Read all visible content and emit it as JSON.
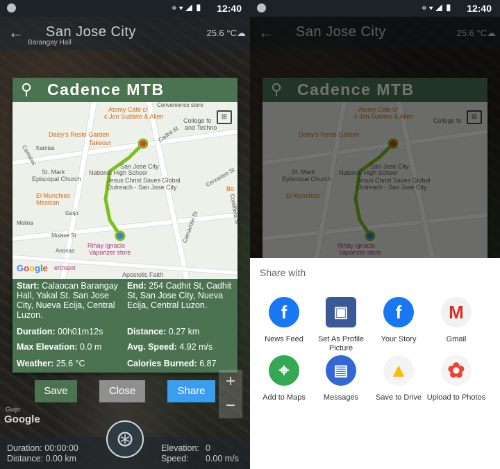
{
  "status": {
    "time": "12:40",
    "icons": "⌖▾◢▮"
  },
  "topbar": {
    "back": "←",
    "title": "San Jose City",
    "weather": "25.6 °C☁"
  },
  "dialog": {
    "app_name": "Cadence MTB",
    "map": {
      "labels": [
        "Atomy Cafe c/",
        "c Jon Sudario & Allen",
        "Daisy's Resto Garden",
        "Takeout",
        "College fo",
        "and Techno",
        "San Jose City",
        "National High School",
        "Jesus Christ Saves Global",
        "Outreach - San Jose City",
        "St. Mark",
        "Episcopal Church",
        "El Munchies",
        "Mexican",
        "Rihay ignacio",
        "Vaporizer store",
        "Apostolic Faith",
        "Kamias",
        "Guijo",
        "Molave St",
        "Anonas",
        "Cadhit St",
        "Cervantes St",
        "Bo",
        "Melina",
        "Camalas",
        "Camachile St",
        "Cordillera St",
        "Convenience store",
        "ertment"
      ],
      "google": "Google"
    },
    "info": {
      "start_label": "Start:",
      "start_value": "Calaocan Barangay Hall, Yakal St. San Jose City, Nueva Ecija, Central Luzon.",
      "end_label": "End:",
      "end_value": "254 Cadhit St, Cadhit St, San Jose City, Nueva Ecija, Central Luzon.",
      "duration_label": "Duration:",
      "duration_value": "00h01m12s",
      "distance_label": "Distance:",
      "distance_value": "0.27 km",
      "max_elev_label": "Max Elevation:",
      "max_elev_value": "0.0 m",
      "avg_speed_label": "Avg. Speed:",
      "avg_speed_value": "4.92 m/s",
      "weather_label": "Weather:",
      "weather_value": "25.6 °C",
      "calories_label": "Calories Burned:",
      "calories_value": "6.87"
    }
  },
  "buttons": {
    "save": "Save",
    "close": "Close",
    "share": "Share"
  },
  "zoom": {
    "in": "+",
    "out": "−"
  },
  "bottom": {
    "duration": "Duration: 00:00:00",
    "distance": "Distance: 0.00 km",
    "elevation_label": "Elevation:",
    "elevation_value": "0",
    "speed_label": "Speed:",
    "speed_value": "0.00 m/s"
  },
  "map_bg_labels": {
    "barangay": "Barangay Hall",
    "google": "Google",
    "guijo": "Guijo"
  },
  "share_sheet": {
    "title": "Share with",
    "apps": [
      {
        "label": "News Feed",
        "icon": "facebook-icon",
        "glyph": "f",
        "color": "#1877f2"
      },
      {
        "label": "Set As Profile Picture",
        "icon": "facebook-profile-icon",
        "glyph": "▣",
        "color": "#3b5998"
      },
      {
        "label": "Your Story",
        "icon": "facebook-icon",
        "glyph": "f",
        "color": "#1877f2"
      },
      {
        "label": "Gmail",
        "icon": "gmail-icon",
        "glyph": "M",
        "color": "#d93025"
      },
      {
        "label": "Add to Maps",
        "icon": "google-maps-icon",
        "glyph": "⌖",
        "color": "#34a853"
      },
      {
        "label": "Messages",
        "icon": "messages-icon",
        "glyph": "▤",
        "color": "#3367d6"
      },
      {
        "label": "Save to Drive",
        "icon": "google-drive-icon",
        "glyph": "▲",
        "color": "#fbbc04"
      },
      {
        "label": "Upload to Photos",
        "icon": "google-photos-icon",
        "glyph": "✿",
        "color": "#ea4335"
      }
    ]
  }
}
